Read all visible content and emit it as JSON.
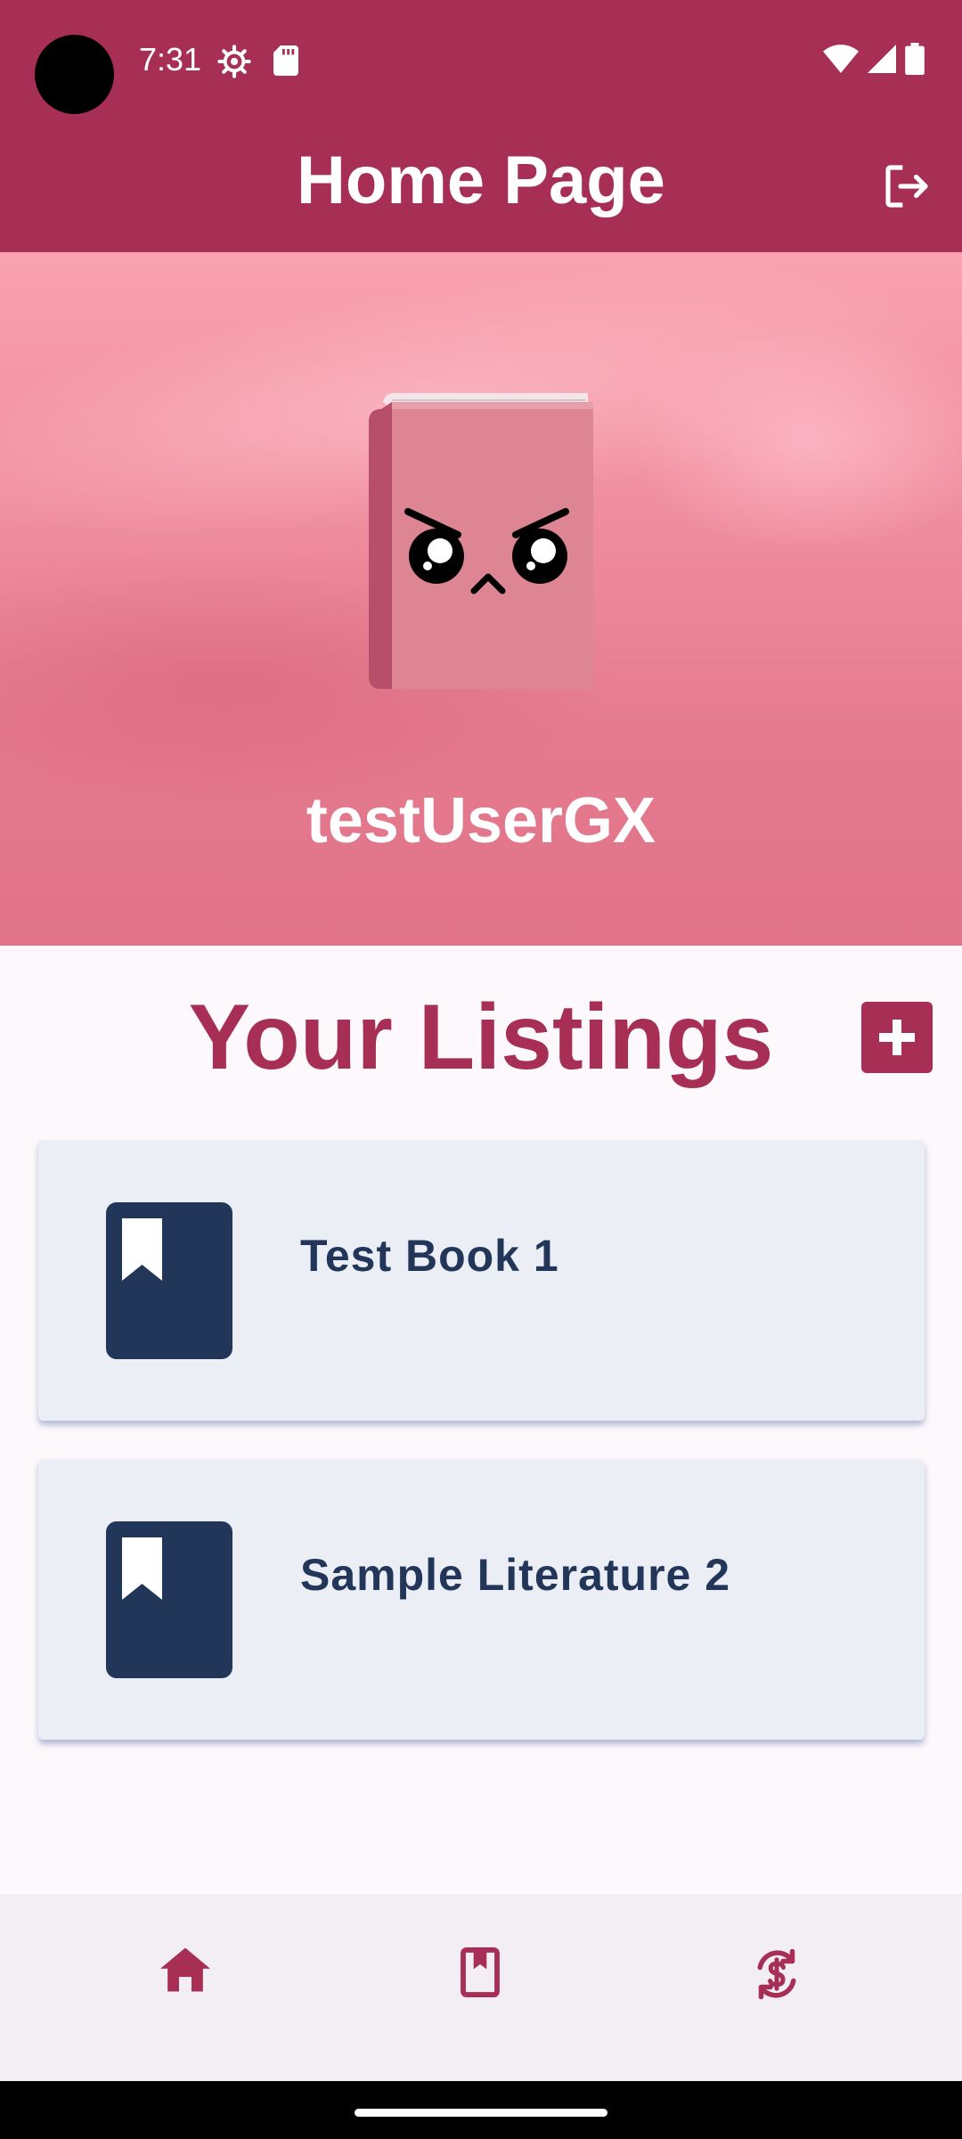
{
  "status_bar": {
    "time": "7:31"
  },
  "header": {
    "title": "Home Page"
  },
  "profile": {
    "username": "testUserGX"
  },
  "listings": {
    "title": "Your Listings",
    "items": [
      {
        "title": "Test Book 1"
      },
      {
        "title": "Sample Literature 2"
      }
    ]
  },
  "colors": {
    "primary": "#a72f55",
    "card_background": "#eceef6",
    "card_text": "#22365a",
    "nav_background": "#f2eef4"
  },
  "icons": {
    "logout": "logout-icon",
    "add": "plus-icon",
    "listing": "bookmark-book-icon",
    "nav": [
      "home-icon",
      "book-icon",
      "currency-exchange-icon"
    ]
  }
}
